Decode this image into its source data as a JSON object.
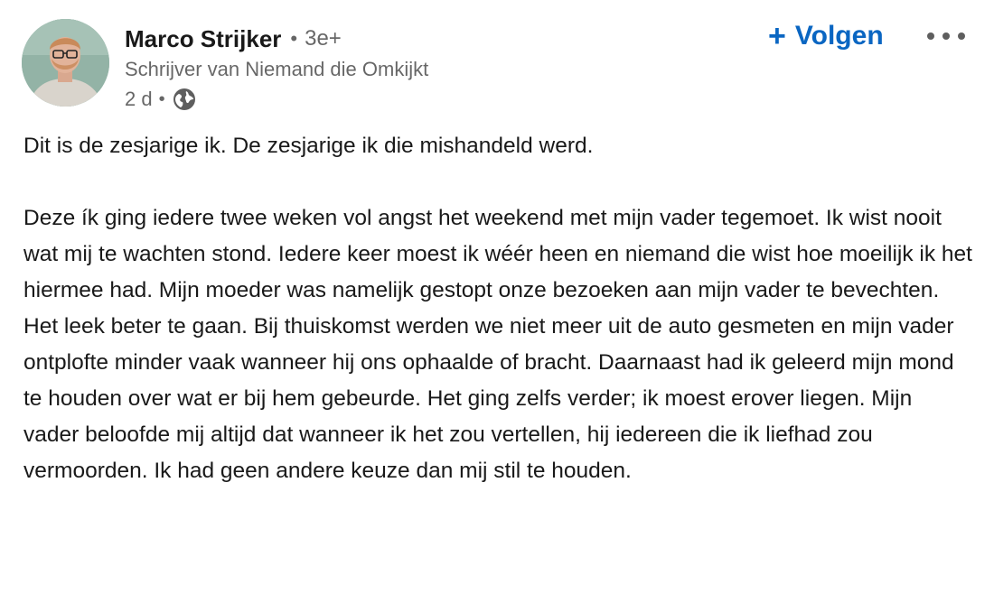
{
  "post": {
    "author": {
      "name": "Marco Strijker",
      "connection_degree": "3e+",
      "headline": "Schrijver van Niemand die Omkijkt",
      "avatar_icon": "profile-photo"
    },
    "meta": {
      "time_ago": "2 d",
      "visibility_icon": "globe-icon"
    },
    "actions": {
      "follow_label": "Volgen",
      "follow_icon": "plus-icon",
      "more_icon": "ellipsis-icon"
    },
    "body": {
      "paragraph_1": "Dit is de zesjarige ik. De zesjarige ik die mishandeld werd.",
      "paragraph_2": "Deze ík ging iedere twee weken vol angst het weekend met mijn vader tegemoet. Ik wist nooit wat mij te wachten stond. Iedere keer moest ik wéér heen en niemand die wist hoe moeilijk ik het hiermee had. Mijn moeder was namelijk gestopt onze bezoeken aan mijn vader te bevechten. Het leek beter te gaan. Bij thuiskomst werden we niet meer uit de auto gesmeten en mijn vader ontplofte minder vaak wanneer hij ons ophaalde of bracht. Daarnaast had ik geleerd mijn mond te houden over wat er bij hem gebeurde. Het ging zelfs verder; ik moest erover liegen. Mijn vader beloofde mij altijd dat wanneer ik het zou vertellen, hij iedereen die ik liefhad zou vermoorden. Ik had geen andere keuze dan mij stil te houden."
    }
  },
  "colors": {
    "accent": "#0a66c2",
    "text_primary": "#1a1a1a",
    "text_secondary": "#666666"
  }
}
